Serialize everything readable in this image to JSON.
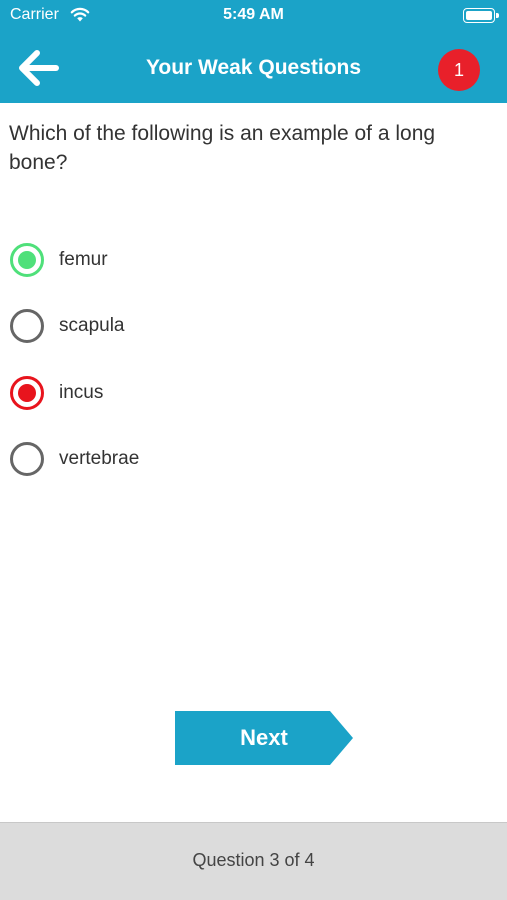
{
  "status_bar": {
    "carrier": "Carrier",
    "time": "5:49 AM",
    "battery_level": 1.0
  },
  "header": {
    "title": "Your Weak Questions",
    "badge_count": "1",
    "back_icon": "arrow-left-icon",
    "background_color": "#1ba3c8"
  },
  "question": {
    "text": "Which of the following is an example of a long bone?"
  },
  "options": [
    {
      "label": "femur",
      "state": "correct"
    },
    {
      "label": "scapula",
      "state": "unselected"
    },
    {
      "label": "incus",
      "state": "wrong"
    },
    {
      "label": "vertebrae",
      "state": "unselected"
    }
  ],
  "next_button": {
    "label": "Next",
    "color": "#1ba3c8"
  },
  "footer": {
    "progress_text": "Question 3 of 4",
    "current": 3,
    "total": 4
  },
  "colors": {
    "correct": "#4fe07a",
    "wrong": "#e8141d",
    "badge": "#e8202a"
  }
}
